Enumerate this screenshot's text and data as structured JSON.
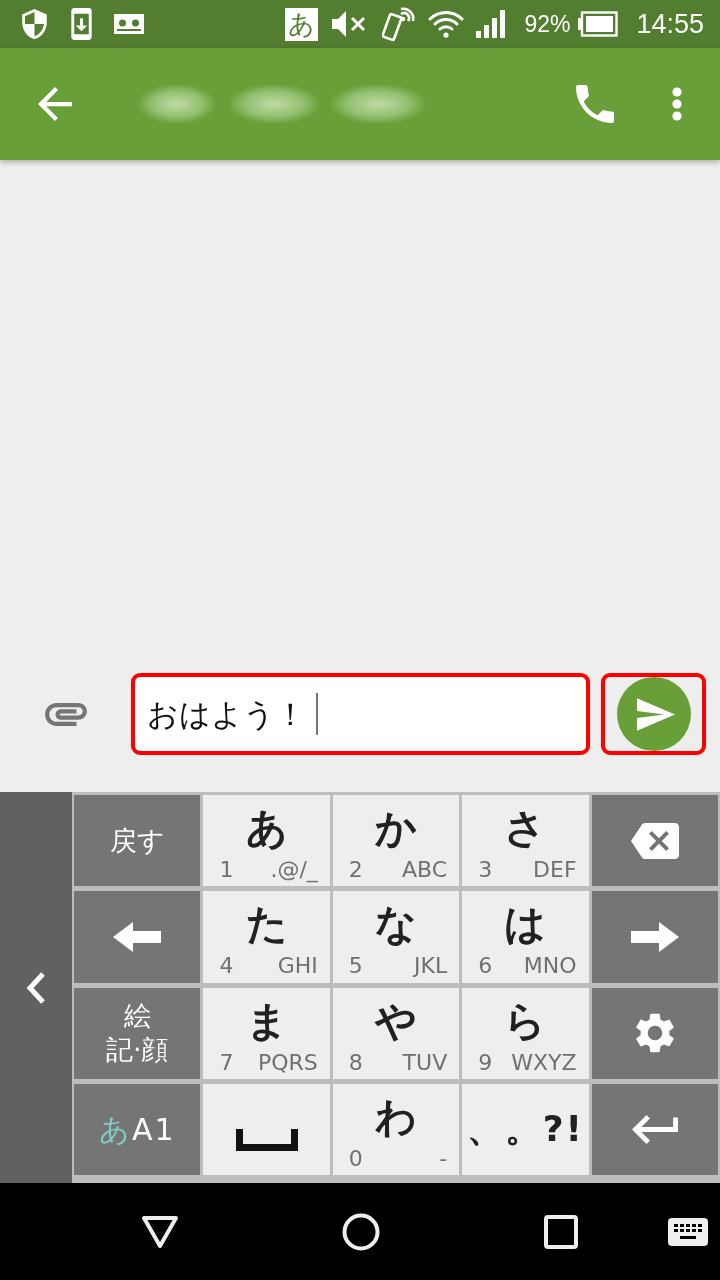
{
  "status_bar": {
    "input_indicator": "あ",
    "battery": "92%",
    "time": "14:55"
  },
  "composer": {
    "message": "おはよう！",
    "highlighted": true,
    "send_highlighted": true
  },
  "keyboard": {
    "rows": [
      [
        {
          "kind": "label",
          "lines": [
            "戻す"
          ]
        },
        {
          "kind": "kana",
          "main": "あ",
          "digit": "1",
          "letters": ".@/_"
        },
        {
          "kind": "kana",
          "main": "か",
          "digit": "2",
          "letters": "ABC"
        },
        {
          "kind": "kana",
          "main": "さ",
          "digit": "3",
          "letters": "DEF"
        },
        {
          "kind": "backspace"
        }
      ],
      [
        {
          "kind": "left"
        },
        {
          "kind": "kana",
          "main": "た",
          "digit": "4",
          "letters": "GHI"
        },
        {
          "kind": "kana",
          "main": "な",
          "digit": "5",
          "letters": "JKL"
        },
        {
          "kind": "kana",
          "main": "は",
          "digit": "6",
          "letters": "MNO"
        },
        {
          "kind": "right"
        }
      ],
      [
        {
          "kind": "label",
          "lines": [
            "絵",
            "記·顔"
          ]
        },
        {
          "kind": "kana",
          "main": "ま",
          "digit": "7",
          "letters": "PQRS"
        },
        {
          "kind": "kana",
          "main": "や",
          "digit": "8",
          "letters": "TUV"
        },
        {
          "kind": "kana",
          "main": "ら",
          "digit": "9",
          "letters": "WXYZ"
        },
        {
          "kind": "settings"
        }
      ],
      [
        {
          "kind": "mode",
          "parts": [
            {
              "text": "あ",
              "selected": true
            },
            {
              "text": "A1",
              "selected": false
            }
          ]
        },
        {
          "kind": "space"
        },
        {
          "kind": "kana",
          "main": "わ",
          "digit": "0",
          "letters": "-"
        },
        {
          "kind": "symbols",
          "label": "、。?!"
        },
        {
          "kind": "enter"
        }
      ]
    ]
  }
}
